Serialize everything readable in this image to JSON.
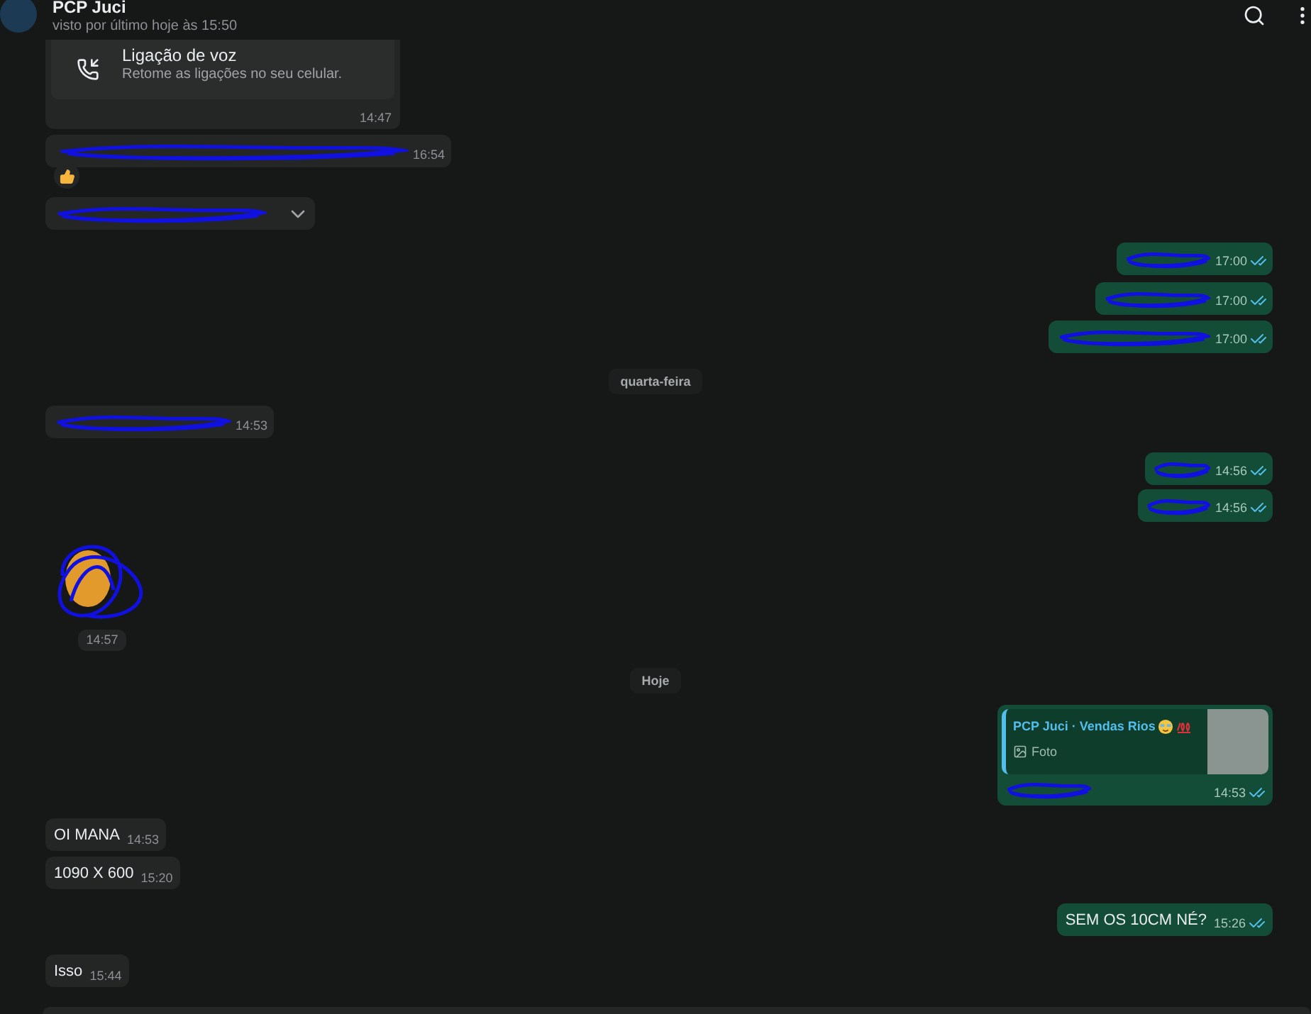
{
  "header": {
    "title": "PCP Juci",
    "status": "visto por último hoje às 15:50"
  },
  "messages": [
    {
      "kind": "call",
      "outgoing": false,
      "title": "Ligação de voz",
      "subtitle": "Retome as ligações no seu celular.",
      "time": "14:47"
    },
    {
      "kind": "redacted",
      "outgoing": false,
      "time": "16:54"
    },
    {
      "kind": "reaction"
    },
    {
      "kind": "redacted",
      "outgoing": false,
      "menu_open": true
    },
    {
      "kind": "redacted",
      "outgoing": true,
      "time": "17:00",
      "read": true
    },
    {
      "kind": "redacted",
      "outgoing": true,
      "time": "17:00",
      "read": true
    },
    {
      "kind": "redacted",
      "outgoing": true,
      "time": "17:00",
      "read": true
    },
    {
      "kind": "date",
      "label": "quarta-feira"
    },
    {
      "kind": "redacted",
      "outgoing": false,
      "time": "14:53"
    },
    {
      "kind": "redacted",
      "outgoing": true,
      "time": "14:56",
      "read": true
    },
    {
      "kind": "redacted",
      "outgoing": true,
      "time": "14:56",
      "read": true
    },
    {
      "kind": "sticker",
      "time": "14:57"
    },
    {
      "kind": "date",
      "label": "Hoje"
    },
    {
      "kind": "reply",
      "outgoing": true,
      "quote_author": "PCP Juci · Vendas Rios",
      "quote_text": "Foto",
      "time": "14:53",
      "read": true
    },
    {
      "kind": "text",
      "outgoing": false,
      "text": "OI MANA",
      "time": "14:53"
    },
    {
      "kind": "text",
      "outgoing": false,
      "text": "1090 X 600",
      "time": "15:20"
    },
    {
      "kind": "text",
      "outgoing": true,
      "text": "SEM OS 10CM NÉ?",
      "time": "15:26",
      "read": true
    },
    {
      "kind": "text",
      "outgoing": false,
      "text": "Isso",
      "time": "15:44"
    }
  ]
}
